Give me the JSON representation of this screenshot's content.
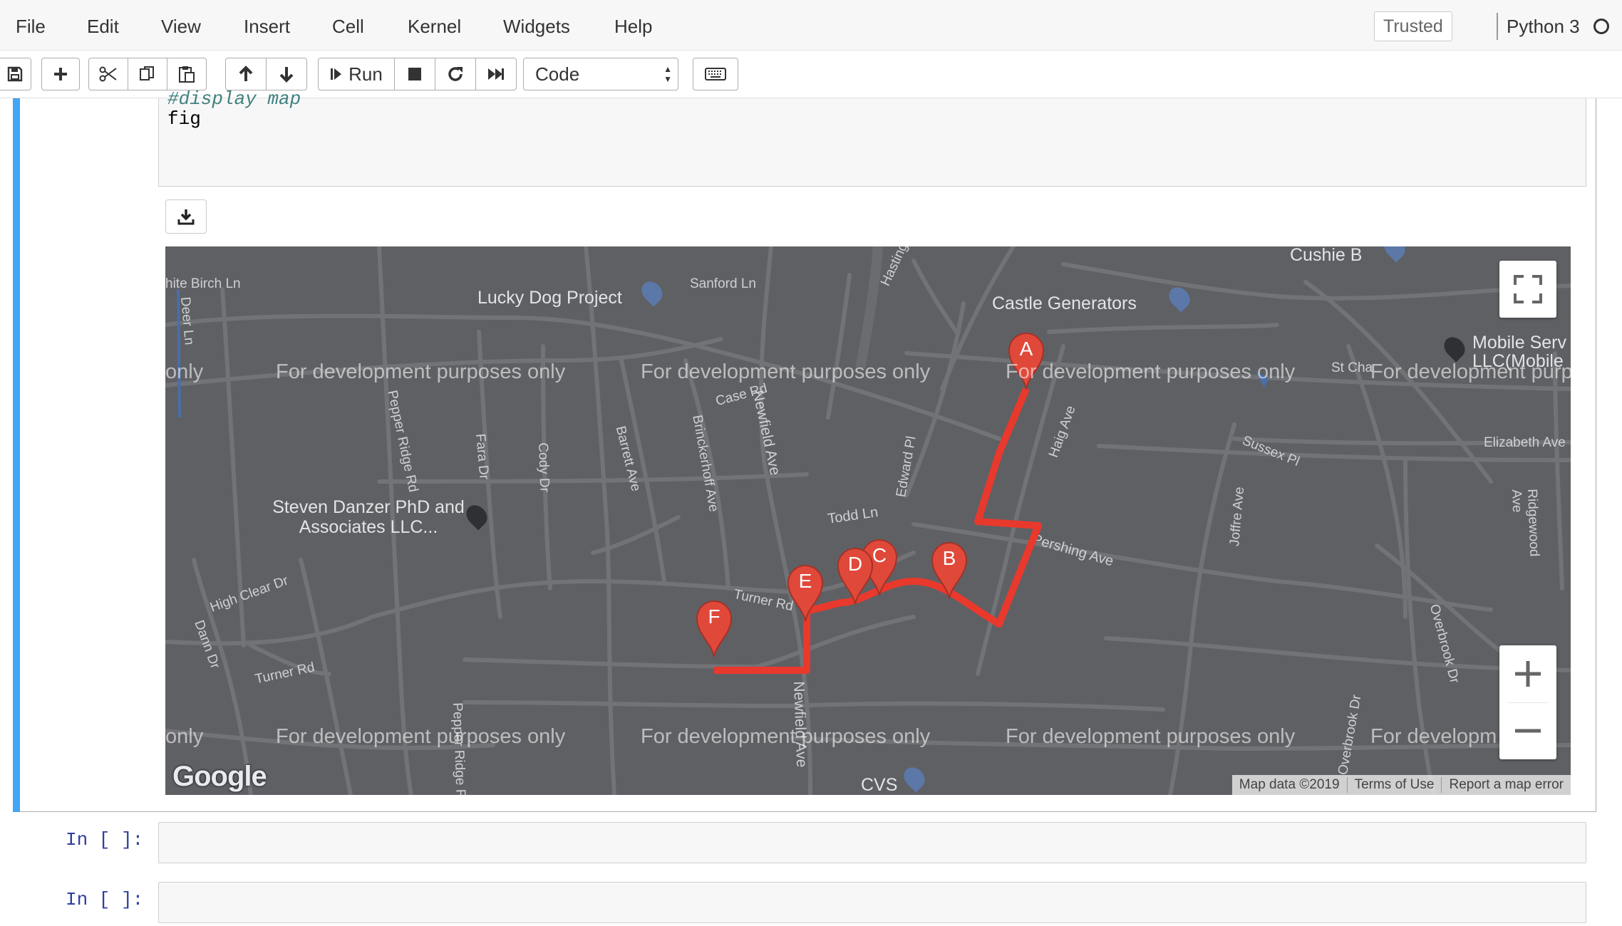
{
  "menu": [
    "File",
    "Edit",
    "View",
    "Insert",
    "Cell",
    "Kernel",
    "Widgets",
    "Help"
  ],
  "trusted": "Trusted",
  "kernel": "Python 3",
  "toolbar": {
    "run_label": "Run",
    "cell_type": "Code"
  },
  "cell": {
    "comment": "#display map",
    "code": "fig"
  },
  "map": {
    "watermark": "For development purposes only",
    "watermark_left_fragment": "only",
    "watermark_right_fragment": "For developm",
    "places": [
      {
        "name": "Lucky Dog Project"
      },
      {
        "name": "Castle Generators"
      },
      {
        "name": "Cushie B"
      },
      {
        "name": "Mobile Serv LLC(Mobile"
      },
      {
        "name": "Steven Danzer PhD and Associates LLC..."
      },
      {
        "name": "CVS"
      }
    ],
    "streets": [
      "hite Birch Ln",
      "Sanford Ln",
      "Hastings Ln",
      "Deer Ln",
      "Case Rd",
      "Newfield Ave",
      "Pepper Ridge Rd",
      "Fara Dr",
      "Cody Dr",
      "Barrett Ave",
      "Brinckerhoff Ave",
      "Edward Pl",
      "Haig Ave",
      "Sussex Pl",
      "Elizabeth Ave",
      "Todd Ln",
      "Pershing Ave",
      "Joffre Ave",
      "Ridgewood Ave",
      "High Clear Dr",
      "Turner Rd",
      "Dann Dr",
      "Overbrook Dr",
      "St Cha"
    ],
    "markers": [
      "A",
      "B",
      "C",
      "D",
      "E",
      "F"
    ],
    "attribution": [
      "Map data ©2019",
      "Terms of Use",
      "Report a map error"
    ],
    "logo": "Google",
    "route_color": "#e8392c"
  },
  "prompts": [
    "In [ ]:",
    "In [ ]:"
  ]
}
